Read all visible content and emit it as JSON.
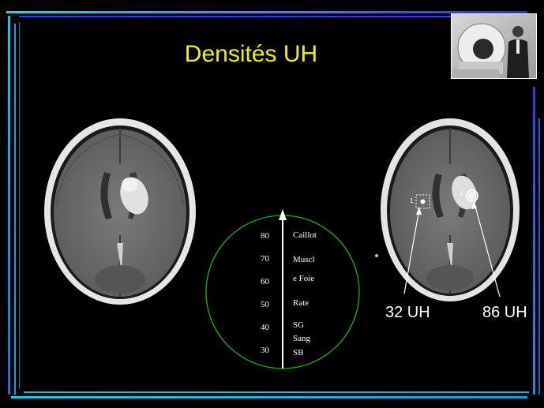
{
  "slide": {
    "title": "Densités UH",
    "annotations": {
      "left": "32 UH",
      "right": "86 UH",
      "roi_1": "1",
      "roi_2": "2"
    },
    "scale": {
      "ticks": [
        "80",
        "70",
        "60",
        "50",
        "40",
        "30"
      ],
      "tissues": [
        "Caillot",
        "Muscl",
        "e Foie",
        "Rate",
        "SG",
        "Sang",
        "SB"
      ]
    },
    "colors": {
      "title": "#f2f200",
      "circle": "#1bb31b",
      "background": "#000000"
    }
  }
}
